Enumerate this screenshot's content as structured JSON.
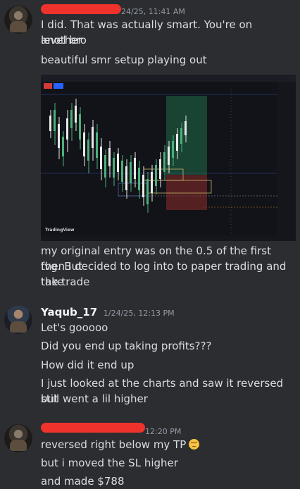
{
  "messages": [
    {
      "timestamp": "24/25, 11:41 AM",
      "lines": [
        "I did. That was actually smart. You're on another",
        "level bro",
        "beautiful smr setup playing out"
      ],
      "attachment": {
        "type": "chart-image",
        "watermark": "TradingView"
      },
      "after_lines": [
        "my original entry was on the 0.5 of the first fvg. But",
        "then I decided to log into to paper trading and take",
        "the trade"
      ]
    },
    {
      "username": "Yaqub_17",
      "timestamp": "1/24/25, 12:13 PM",
      "lines": [
        "Let's gooooo",
        "Did you end up taking profits???",
        "How did it end up",
        "I just looked at the charts and saw it reversed but",
        "still went a lil higher"
      ]
    },
    {
      "timestamp": "12:20 PM",
      "lines": [
        "reversed right below my TP",
        "but i moved the SL higher",
        "and made $788"
      ],
      "emoji": "worried-face-emoji"
    }
  ],
  "colors": {
    "background": "#2b2d31",
    "text": "#dbdee1",
    "username": "#f2f3f5",
    "timestamp": "#949ba4",
    "redaction": "#f0322c"
  }
}
